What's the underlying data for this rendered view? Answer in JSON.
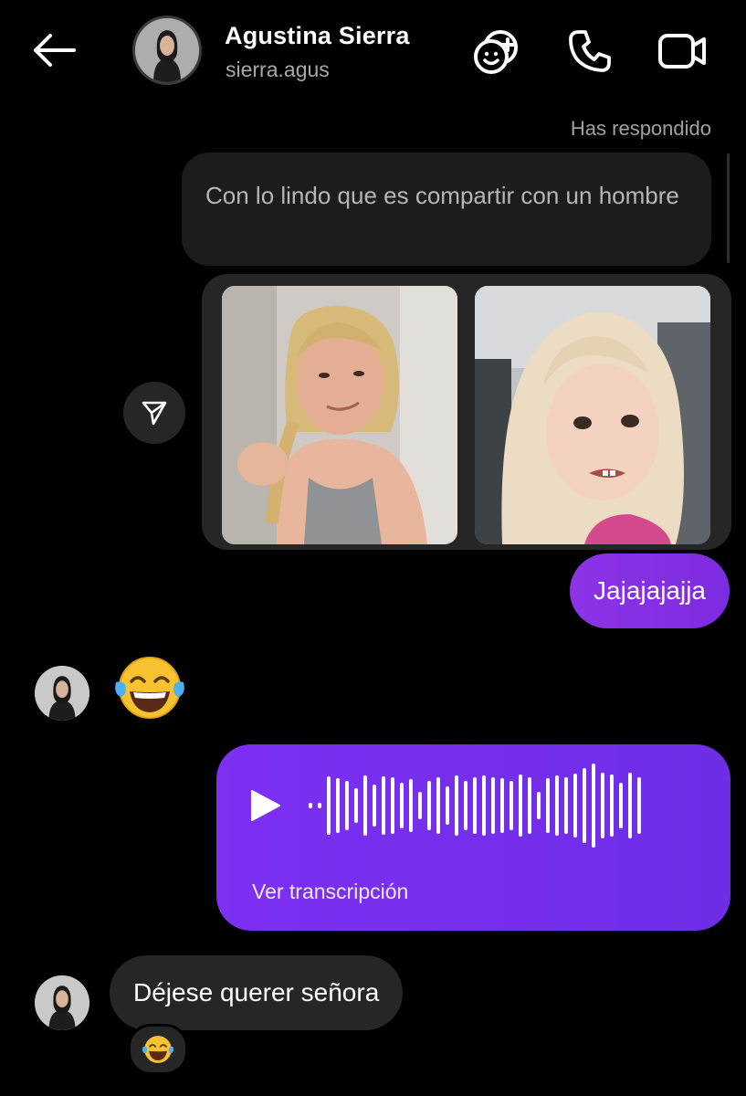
{
  "header": {
    "name": "Agustina Sierra",
    "username": "sierra.agus"
  },
  "icons": {
    "back": "arrow-left-icon",
    "effects": "sticker-plus-icon",
    "call": "phone-icon",
    "video": "video-camera-icon",
    "share": "paper-plane-icon",
    "play": "play-icon"
  },
  "conversation": {
    "reply_label": "Has respondido",
    "reply_quote": "Con lo lindo que es compartir con un hombre",
    "images": [
      {
        "description": "woman-braiding-hair-meme"
      },
      {
        "description": "side-eye-girl-meme"
      }
    ],
    "sent_text": "Jajajajajja",
    "received_emoji": "😂",
    "voice_message": {
      "transcript_link": "Ver transcripción"
    },
    "received_text": "Déjese querer señora",
    "reaction": "😂"
  },
  "colors": {
    "background": "#000000",
    "sent_bubble": "#8a2be2",
    "voice_bubble": "#7b2ff0",
    "received_bubble": "#262626"
  }
}
